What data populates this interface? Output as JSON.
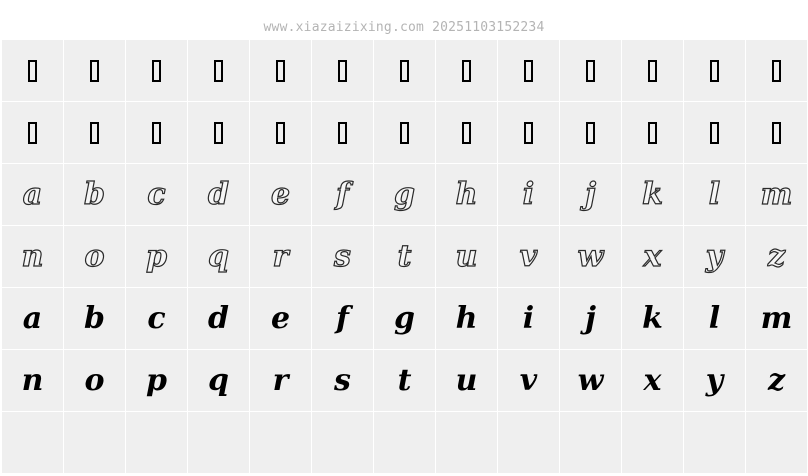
{
  "header": {
    "watermark": "www.xiazaizixing.com 20251103152234"
  },
  "rows": [
    {
      "style": "notdef",
      "glyphs": [
        "",
        "",
        "",
        "",
        "",
        "",
        "",
        "",
        "",
        "",
        "",
        "",
        ""
      ]
    },
    {
      "style": "notdef",
      "glyphs": [
        "",
        "",
        "",
        "",
        "",
        "",
        "",
        "",
        "",
        "",
        "",
        "",
        ""
      ]
    },
    {
      "style": "outline",
      "glyphs": [
        "a",
        "b",
        "c",
        "d",
        "e",
        "f",
        "g",
        "h",
        "i",
        "j",
        "k",
        "l",
        "m"
      ]
    },
    {
      "style": "outline",
      "glyphs": [
        "n",
        "o",
        "p",
        "q",
        "r",
        "s",
        "t",
        "u",
        "v",
        "w",
        "x",
        "y",
        "z"
      ]
    },
    {
      "style": "solid",
      "glyphs": [
        "a",
        "b",
        "c",
        "d",
        "e",
        "f",
        "g",
        "h",
        "i",
        "j",
        "k",
        "l",
        "m"
      ]
    },
    {
      "style": "solid",
      "glyphs": [
        "n",
        "o",
        "p",
        "q",
        "r",
        "s",
        "t",
        "u",
        "v",
        "w",
        "x",
        "y",
        "z"
      ]
    },
    {
      "style": "empty",
      "glyphs": [
        "",
        "",
        "",
        "",
        "",
        "",
        "",
        "",
        "",
        "",
        "",
        "",
        ""
      ]
    }
  ]
}
